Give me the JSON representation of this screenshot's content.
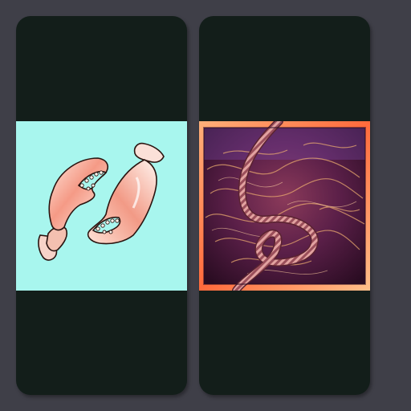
{
  "cards": [
    {
      "id": "card-1",
      "thumbnail": {
        "subject": "crab-claws-icon",
        "background_color": "#a8f6ee",
        "claw_color": "#f4a48e"
      }
    },
    {
      "id": "card-2",
      "thumbnail": {
        "subject": "twisted-rope-icon",
        "background_color": "#6a2a55",
        "rope_color": "#d89a9a"
      }
    }
  ],
  "colors": {
    "page_background": "#3f3f48",
    "card_background": "#131e1a"
  }
}
